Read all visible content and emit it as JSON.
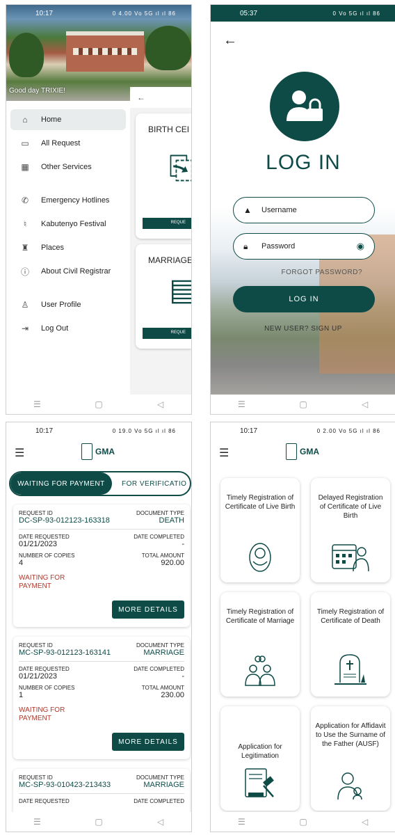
{
  "panel1": {
    "status": {
      "time": "10:17",
      "right": "0 4.00 Vo 5G ıl ıl 86"
    },
    "greeting": "Good day TRIXIE!",
    "menu": [
      {
        "label": "Home",
        "icon": "home-icon",
        "glyph": "⌂",
        "active": true
      },
      {
        "label": "All Request",
        "icon": "folder-icon",
        "glyph": "▭"
      },
      {
        "label": "Other Services",
        "icon": "calendar-icon",
        "glyph": "▦"
      },
      {
        "label": "Emergency Hotlines",
        "icon": "phone-icon",
        "glyph": "✆"
      },
      {
        "label": "Kabutenyo Festival",
        "icon": "festival-icon",
        "glyph": "♮"
      },
      {
        "label": "Places",
        "icon": "building-icon",
        "glyph": "♜"
      },
      {
        "label": "About Civil Registrar",
        "icon": "info-icon",
        "glyph": "ⓘ"
      },
      {
        "label": "User Profile",
        "icon": "user-icon",
        "glyph": "♙"
      },
      {
        "label": "Log Out",
        "icon": "logout-icon",
        "glyph": "⇥"
      }
    ],
    "behind": {
      "card1_title": "BIRTH CEI",
      "card2_title": "MARRIAGE C",
      "button": "REQUE"
    }
  },
  "panel2": {
    "status": {
      "time": "05:37",
      "right": "0 Vo 5G ıl ıl 86"
    },
    "title": "LOG IN",
    "username_placeholder": "Username",
    "password_placeholder": "Password",
    "forgot": "FORGOT PASSWORD?",
    "login_button": "LOG IN",
    "signup": "NEW USER? SIGN UP",
    "accent": "#0e4b47"
  },
  "panel3": {
    "status": {
      "time": "10:17",
      "right": "0 19.0 Vo 5G ıl ıl 86"
    },
    "brand": "GMA",
    "tabs": [
      "WAITING FOR PAYMENT",
      "FOR VERIFICATIO"
    ],
    "labels": {
      "request_id": "REQUEST ID",
      "document_type": "DOCUMENT TYPE",
      "date_requested": "DATE REQUESTED",
      "date_completed": "DATE COMPLETED",
      "copies": "NUMBER OF COPIES",
      "total": "TOTAL AMOUNT",
      "more": "MORE DETAILS"
    },
    "requests": [
      {
        "id": "DC-SP-93-012123-163318",
        "type": "DEATH",
        "date_requested": "01/21/2023",
        "date_completed": "-",
        "copies": "4",
        "total": "920.00",
        "status": "WAITING FOR PAYMENT"
      },
      {
        "id": "MC-SP-93-012123-163141",
        "type": "MARRIAGE",
        "date_requested": "01/21/2023",
        "date_completed": "-",
        "copies": "1",
        "total": "230.00",
        "status": "WAITING FOR PAYMENT"
      },
      {
        "id": "MC-SP-93-010423-213433",
        "type": "MARRIAGE"
      }
    ]
  },
  "panel4": {
    "status": {
      "time": "10:17",
      "right": "0 2.00 Vo 5G ıl ıl 86"
    },
    "brand": "GMA",
    "services": [
      {
        "title": "Timely Registration of Certificate of Live Birth",
        "icon": "baby-icon"
      },
      {
        "title": "Delayed Registration of Certificate of Live Birth",
        "icon": "calendar-person-icon"
      },
      {
        "title": "Timely Registration of Certificate of Marriage",
        "icon": "couple-icon"
      },
      {
        "title": "Timely Registration of Certificate of Death",
        "icon": "tombstone-icon"
      },
      {
        "title": "Application for Legitimation",
        "icon": "gavel-document-icon"
      },
      {
        "title": "Application for Affidavit to Use the Surname of the Father (AUSF)",
        "icon": "father-child-icon"
      }
    ]
  },
  "nav": {
    "recents": "☰",
    "home": "▢",
    "back": "◁"
  }
}
